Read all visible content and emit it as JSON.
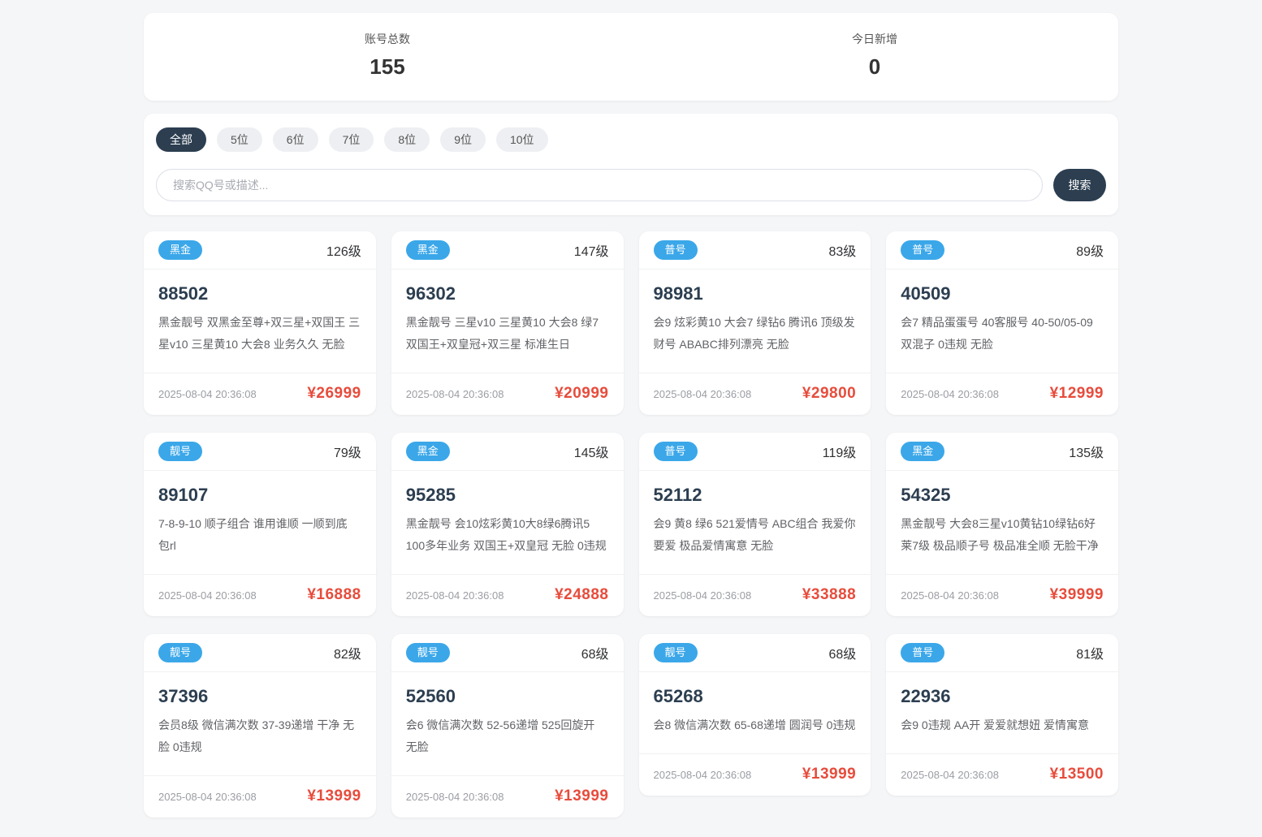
{
  "stats": {
    "total_label": "账号总数",
    "total_value": "155",
    "today_label": "今日新增",
    "today_value": "0"
  },
  "filters": {
    "tabs": [
      {
        "label": "全部",
        "active": true
      },
      {
        "label": "5位",
        "active": false
      },
      {
        "label": "6位",
        "active": false
      },
      {
        "label": "7位",
        "active": false
      },
      {
        "label": "8位",
        "active": false
      },
      {
        "label": "9位",
        "active": false
      },
      {
        "label": "10位",
        "active": false
      }
    ]
  },
  "search": {
    "placeholder": "搜索QQ号或描述...",
    "button_label": "搜索"
  },
  "colors": {
    "badge_blue": "#3ba7e9",
    "price_red": "#e74c3c",
    "dark_navy": "#2c3e50",
    "page_background": "#f5f6f8"
  },
  "cards": [
    {
      "badge": "黑金",
      "level": "126级",
      "number": "88502",
      "description": "黑金靓号 双黑金至尊+双三星+双国王 三星v10 三星黄10 大会8 业务久久 无脸",
      "date": "2025-08-04 20:36:08",
      "price": "¥26999"
    },
    {
      "badge": "黑金",
      "level": "147级",
      "number": "96302",
      "description": "黑金靓号 三星v10 三星黄10 大会8 绿7 双国王+双皇冠+双三星 标准生日",
      "date": "2025-08-04 20:36:08",
      "price": "¥20999"
    },
    {
      "badge": "普号",
      "level": "83级",
      "number": "98981",
      "description": "会9 炫彩黄10 大会7 绿钻6 腾讯6 顶级发财号 ABABC排列漂亮 无脸",
      "date": "2025-08-04 20:36:08",
      "price": "¥29800"
    },
    {
      "badge": "普号",
      "level": "89级",
      "number": "40509",
      "description": "会7 精品蛋蛋号 40客服号 40-50/05-09 双混子 0违规 无脸",
      "date": "2025-08-04 20:36:08",
      "price": "¥12999"
    },
    {
      "badge": "靓号",
      "level": "79级",
      "number": "89107",
      "description": "7-8-9-10 顺子组合 谁用谁顺 一顺到底 包rl",
      "date": "2025-08-04 20:36:08",
      "price": "¥16888"
    },
    {
      "badge": "黑金",
      "level": "145级",
      "number": "95285",
      "description": "黑金靓号 会10炫彩黄10大8绿6腾讯5 100多年业务 双国王+双皇冠 无脸 0违规",
      "date": "2025-08-04 20:36:08",
      "price": "¥24888"
    },
    {
      "badge": "普号",
      "level": "119级",
      "number": "52112",
      "description": "会9 黄8 绿6 521爱情号 ABC组合 我爱你要爱 极品爱情寓意 无脸",
      "date": "2025-08-04 20:36:08",
      "price": "¥33888"
    },
    {
      "badge": "黑金",
      "level": "135级",
      "number": "54325",
      "description": "黑金靓号 大会8三星v10黄钻10绿钻6好莱7级 极品顺子号 极品准全顺 无脸干净",
      "date": "2025-08-04 20:36:08",
      "price": "¥39999"
    },
    {
      "badge": "靓号",
      "level": "82级",
      "number": "37396",
      "description": "会员8级 微信满次数 37-39递增 干净 无脸 0违规",
      "date": "2025-08-04 20:36:08",
      "price": "¥13999"
    },
    {
      "badge": "靓号",
      "level": "68级",
      "number": "52560",
      "description": "会6 微信满次数 52-56递增 525回旋开 无脸",
      "date": "2025-08-04 20:36:08",
      "price": "¥13999"
    },
    {
      "badge": "靓号",
      "level": "68级",
      "number": "65268",
      "description": "会8 微信满次数 65-68递增 圆润号 0违规",
      "date": "2025-08-04 20:36:08",
      "price": "¥13999"
    },
    {
      "badge": "普号",
      "level": "81级",
      "number": "22936",
      "description": "会9 0违规 AA开 爱爱就想妞 爱情寓意",
      "date": "2025-08-04 20:36:08",
      "price": "¥13500"
    }
  ]
}
